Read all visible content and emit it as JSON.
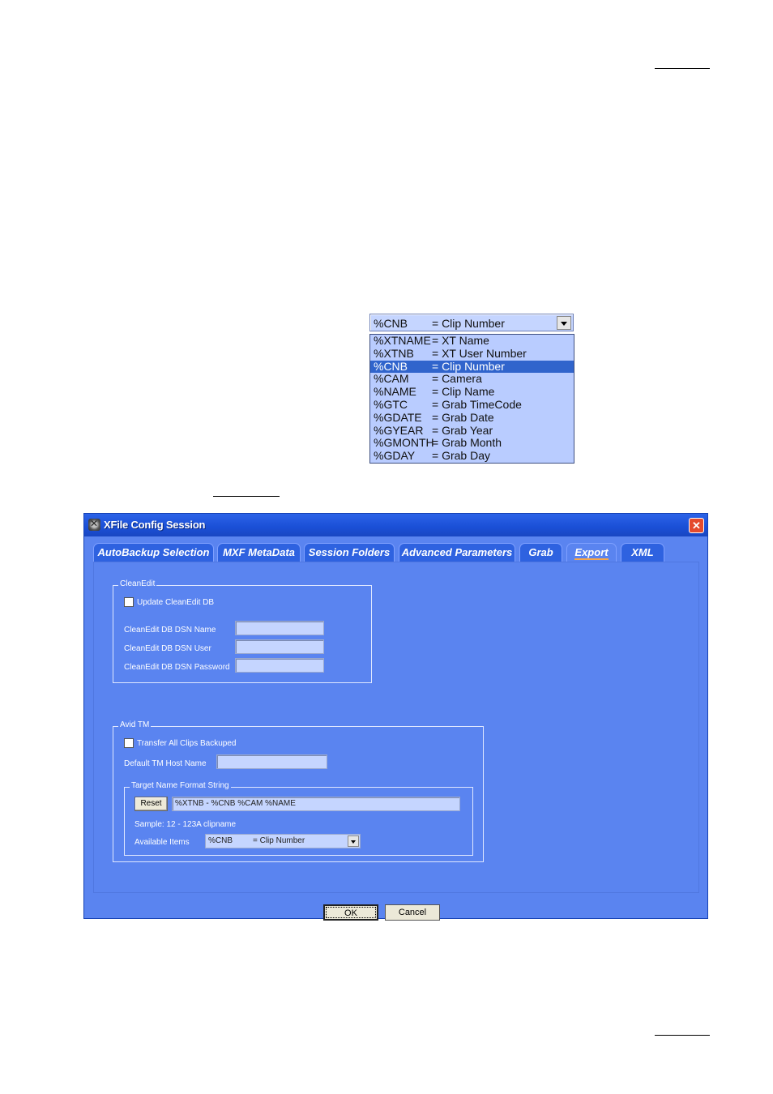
{
  "dropdown_example": {
    "selected": {
      "code": "%CNB",
      "desc": "= Clip Number"
    },
    "items": [
      {
        "code": "%XTNAME",
        "desc": "= XT Name"
      },
      {
        "code": "%XTNB",
        "desc": "= XT User Number"
      },
      {
        "code": "%CNB",
        "desc": "= Clip Number",
        "selected": true
      },
      {
        "code": "%CAM",
        "desc": "= Camera"
      },
      {
        "code": "%NAME",
        "desc": "= Clip Name"
      },
      {
        "code": "%GTC",
        "desc": "= Grab TimeCode"
      },
      {
        "code": "%GDATE",
        "desc": "= Grab Date"
      },
      {
        "code": "%GYEAR",
        "desc": "= Grab Year"
      },
      {
        "code": "%GMONTH",
        "desc": "= Grab Month"
      },
      {
        "code": "%GDAY",
        "desc": "= Grab Day"
      }
    ]
  },
  "window": {
    "title": "XFile Config Session",
    "close_glyph": "✕",
    "tabs": [
      {
        "label": "AutoBackup Selection"
      },
      {
        "label": "MXF MetaData"
      },
      {
        "label": "Session Folders"
      },
      {
        "label": "Advanced Parameters"
      },
      {
        "label": "Grab"
      },
      {
        "label": "Export",
        "active": true
      },
      {
        "label": "XML"
      }
    ],
    "cleanedit": {
      "group_label": "CleanEdit",
      "update_checkbox_label": "Update CleanEdit DB",
      "dsn_name_label": "CleanEdit DB DSN Name",
      "dsn_user_label": "CleanEdit DB DSN User",
      "dsn_password_label": "CleanEdit DB DSN Password",
      "dsn_name_value": "",
      "dsn_user_value": "",
      "dsn_password_value": ""
    },
    "avid": {
      "group_label": "Avid TM",
      "transfer_checkbox_label": "Transfer All Clips Backuped",
      "host_label": "Default TM Host Name",
      "host_value": "",
      "target_group_label": "Target Name Format String",
      "reset_label": "Reset",
      "format_value": "%XTNB - %CNB %CAM %NAME",
      "sample_text": "Sample: 12 - 123A clipname",
      "available_label": "Available Items",
      "available_code": "%CNB",
      "available_desc": "= Clip Number"
    },
    "ok_label": "OK",
    "cancel_label": "Cancel"
  }
}
